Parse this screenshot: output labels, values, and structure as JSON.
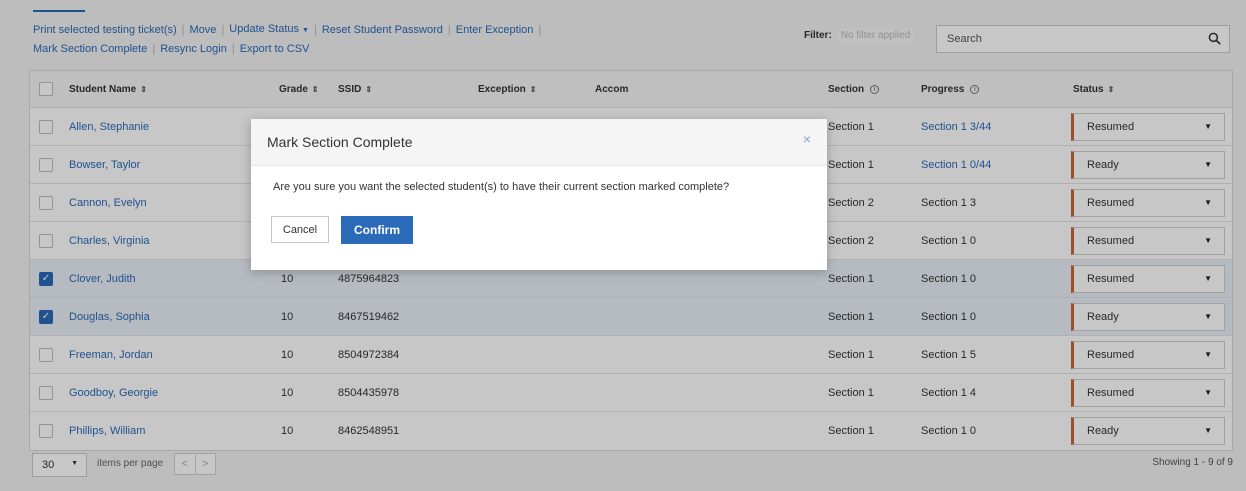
{
  "toolbar": {
    "row1": [
      "Print selected testing ticket(s)",
      "Move",
      "Update Status",
      "Reset Student Password",
      "Enter Exception"
    ],
    "row2": [
      "Mark Section Complete",
      "Resync Login",
      "Export to CSV"
    ]
  },
  "filter": {
    "label": "Filter:",
    "value": "No filter applied"
  },
  "search": {
    "placeholder": "Search"
  },
  "table": {
    "headers": {
      "name": "Student Name",
      "grade": "Grade",
      "ssid": "SSID",
      "exception": "Exception",
      "accom": "Accom",
      "section": "Section",
      "progress": "Progress",
      "status": "Status"
    },
    "rows": [
      {
        "name": "Allen, Stephanie",
        "grade": "",
        "ssid": "",
        "section": "Section 1",
        "progress": "Section 1 3/44",
        "progress_link": true,
        "status": "Resumed",
        "checked": false
      },
      {
        "name": "Bowser, Taylor",
        "grade": "",
        "ssid": "",
        "section": "Section 1",
        "progress": "Section 1 0/44",
        "progress_link": true,
        "status": "Ready",
        "checked": false
      },
      {
        "name": "Cannon, Evelyn",
        "grade": "",
        "ssid": "",
        "section": "Section 2",
        "progress": "Section 1 3",
        "progress_link": false,
        "status": "Resumed",
        "checked": false
      },
      {
        "name": "Charles, Virginia",
        "grade": "",
        "ssid": "",
        "section": "Section 2",
        "progress": "Section 1 0",
        "progress_link": false,
        "status": "Resumed",
        "checked": false
      },
      {
        "name": "Clover, Judith",
        "grade": "10",
        "ssid": "4875964823",
        "section": "Section 1",
        "progress": "Section 1 0",
        "progress_link": false,
        "status": "Resumed",
        "checked": true
      },
      {
        "name": "Douglas, Sophia",
        "grade": "10",
        "ssid": "8467519462",
        "section": "Section 1",
        "progress": "Section 1 0",
        "progress_link": false,
        "status": "Ready",
        "checked": true
      },
      {
        "name": "Freeman, Jordan",
        "grade": "10",
        "ssid": "8504972384",
        "section": "Section 1",
        "progress": "Section 1 5",
        "progress_link": false,
        "status": "Resumed",
        "checked": false
      },
      {
        "name": "Goodboy, Georgie",
        "grade": "10",
        "ssid": "8504435978",
        "section": "Section 1",
        "progress": "Section 1 4",
        "progress_link": false,
        "status": "Resumed",
        "checked": false
      },
      {
        "name": "Phillips, William",
        "grade": "10",
        "ssid": "8462548951",
        "section": "Section 1",
        "progress": "Section 1 0",
        "progress_link": false,
        "status": "Ready",
        "checked": false
      }
    ]
  },
  "footer": {
    "per_page": "30",
    "per_page_label": "items per page",
    "prev": "<",
    "next": ">",
    "showing": "Showing 1 - 9 of 9"
  },
  "modal": {
    "title": "Mark Section Complete",
    "close": "×",
    "body": "Are you sure you want the selected student(s) to have their current section marked complete?",
    "cancel": "Cancel",
    "confirm": "Confirm"
  },
  "colors": {
    "link": "#2a6ab9",
    "status_accent": "#cc6633",
    "selected_row": "#eaf0f8"
  }
}
